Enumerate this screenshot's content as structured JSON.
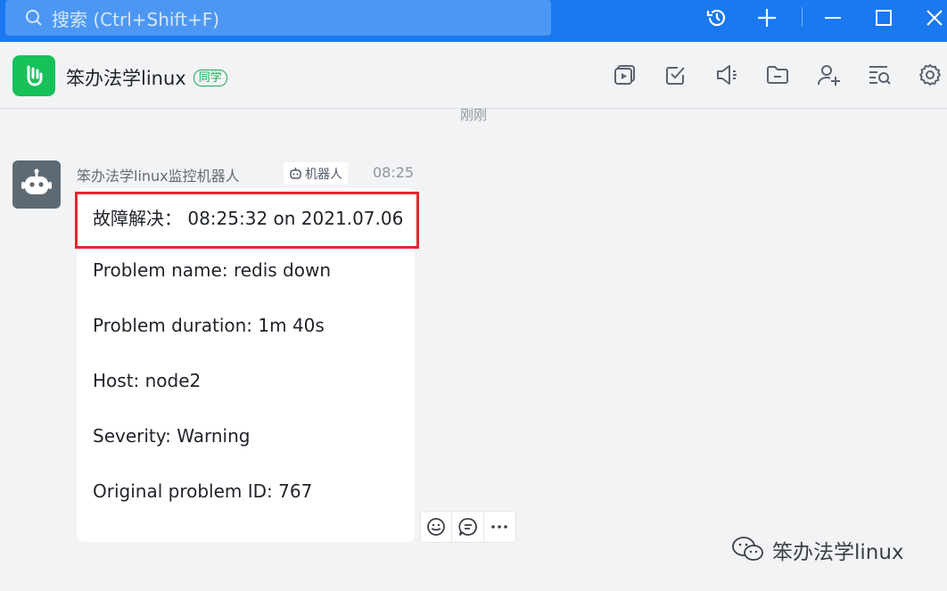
{
  "search": {
    "placeholder": "搜索 (Ctrl+Shift+F)"
  },
  "window_controls": {
    "icons": [
      "history-icon",
      "plus-icon",
      "minimize-icon",
      "maximize-icon",
      "close-icon"
    ]
  },
  "chat": {
    "title": "笨办法学linux",
    "badge": "同学",
    "toolbar_icons": [
      "screen-share-icon",
      "task-icon",
      "announcement-icon",
      "folder-icon",
      "add-member-icon",
      "search-history-icon",
      "settings-icon"
    ]
  },
  "messages": {
    "time_separator": "刚刚",
    "sender": "笨办法学linux监控机器人",
    "robot_tag": "机器人",
    "time": "08:25",
    "lines": [
      "故障解决：  08:25:32 on 2021.07.06",
      "Problem name: redis down",
      "Problem duration: 1m 40s",
      "Host: node2",
      "Severity: Warning",
      "Original problem ID: 767"
    ]
  },
  "reactions": {
    "icons": [
      "emoji-icon",
      "reply-icon",
      "more-icon"
    ]
  },
  "watermark": {
    "text": "笨办法学linux"
  },
  "colors": {
    "topbar": "#1a78f0",
    "brand_green": "#16c15a",
    "highlight_red": "#e5262e"
  }
}
